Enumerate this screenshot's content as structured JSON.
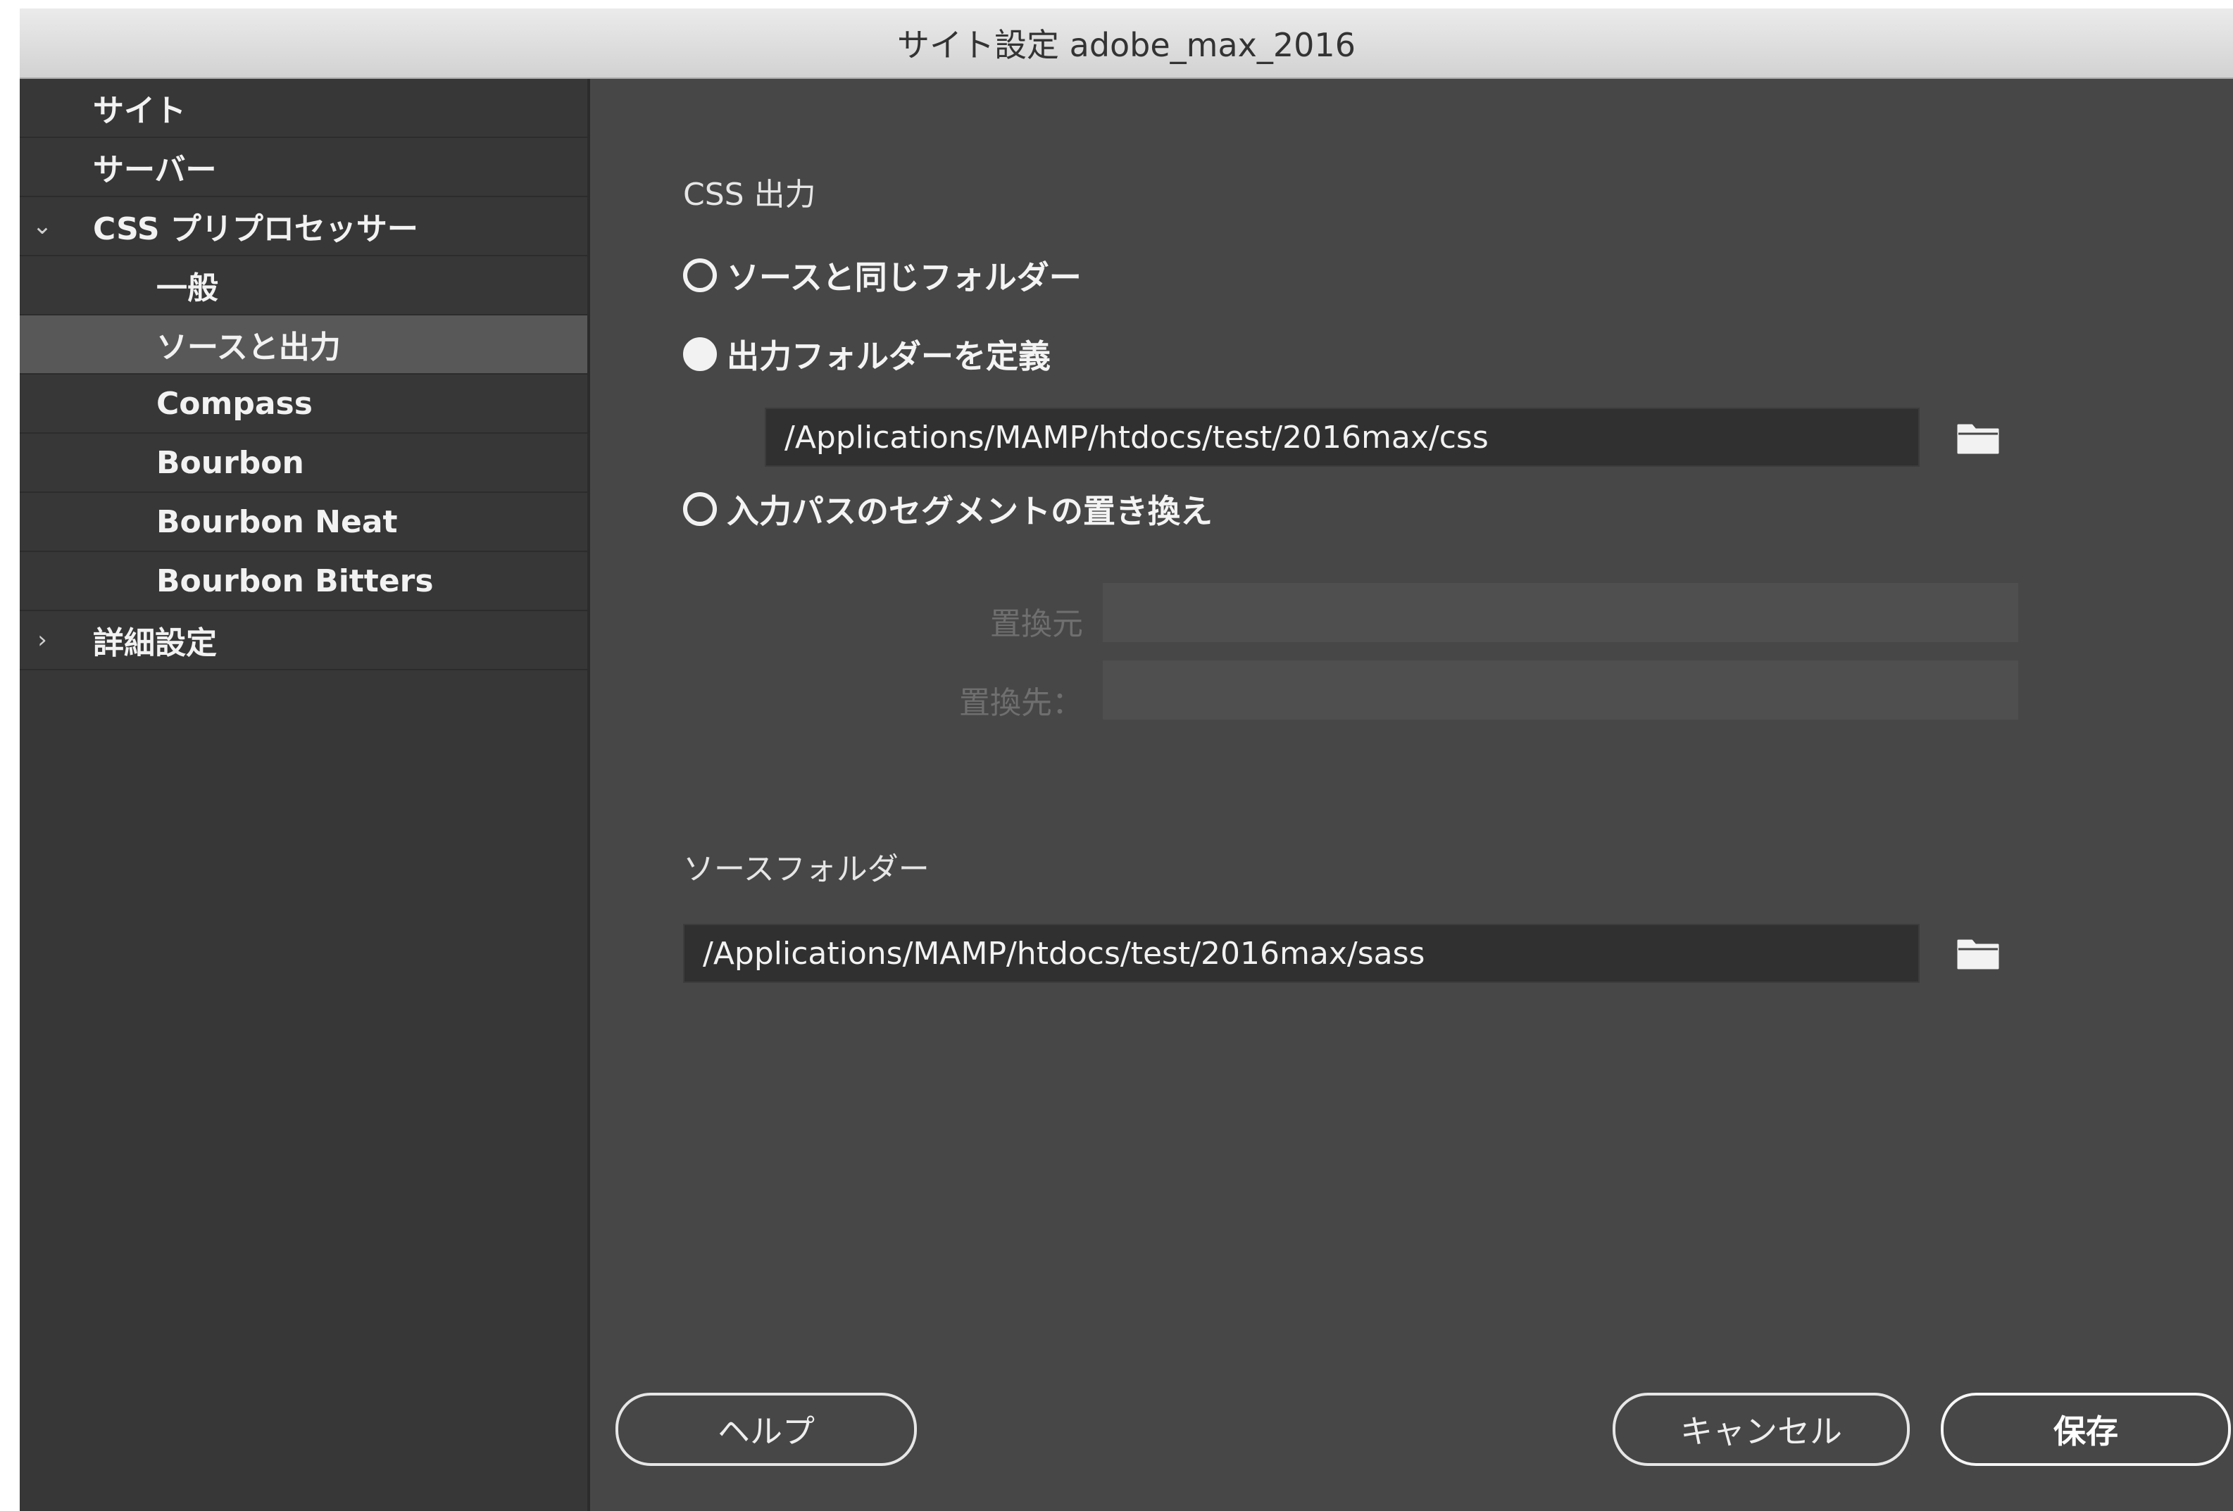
{
  "window": {
    "title": "サイト設定 adobe_max_2016"
  },
  "sidebar": {
    "items": [
      {
        "label": "サイト"
      },
      {
        "label": "サーバー"
      },
      {
        "label": "CSS プリプロセッサー",
        "chevron": "⌄"
      },
      {
        "label": "一般"
      },
      {
        "label": "ソースと出力"
      },
      {
        "label": "Compass"
      },
      {
        "label": "Bourbon"
      },
      {
        "label": "Bourbon Neat"
      },
      {
        "label": "Bourbon Bitters"
      },
      {
        "label": "詳細設定",
        "chevron": "›"
      }
    ]
  },
  "main": {
    "css_output_label": "CSS 出力",
    "options": [
      {
        "label": "ソースと同じフォルダー",
        "checked": false
      },
      {
        "label": "出力フォルダーを定義",
        "checked": true
      },
      {
        "label": "入力パスのセグメントの置き換え",
        "checked": false
      }
    ],
    "output_folder_value": "/Applications/MAMP/htdocs/test/2016max/css",
    "replace_from_label": "置換元",
    "replace_to_label": "置換先：",
    "source_folder_label": "ソースフォルダー",
    "source_folder_value": "/Applications/MAMP/htdocs/test/2016max/sass"
  },
  "buttons": {
    "help": "ヘルプ",
    "cancel": "キャンセル",
    "save": "保存"
  },
  "icons": {
    "folder": "folder-icon"
  },
  "colors": {
    "background": "#474747",
    "sidebar": "#373737",
    "selected": "#585858",
    "field": "#303030"
  }
}
